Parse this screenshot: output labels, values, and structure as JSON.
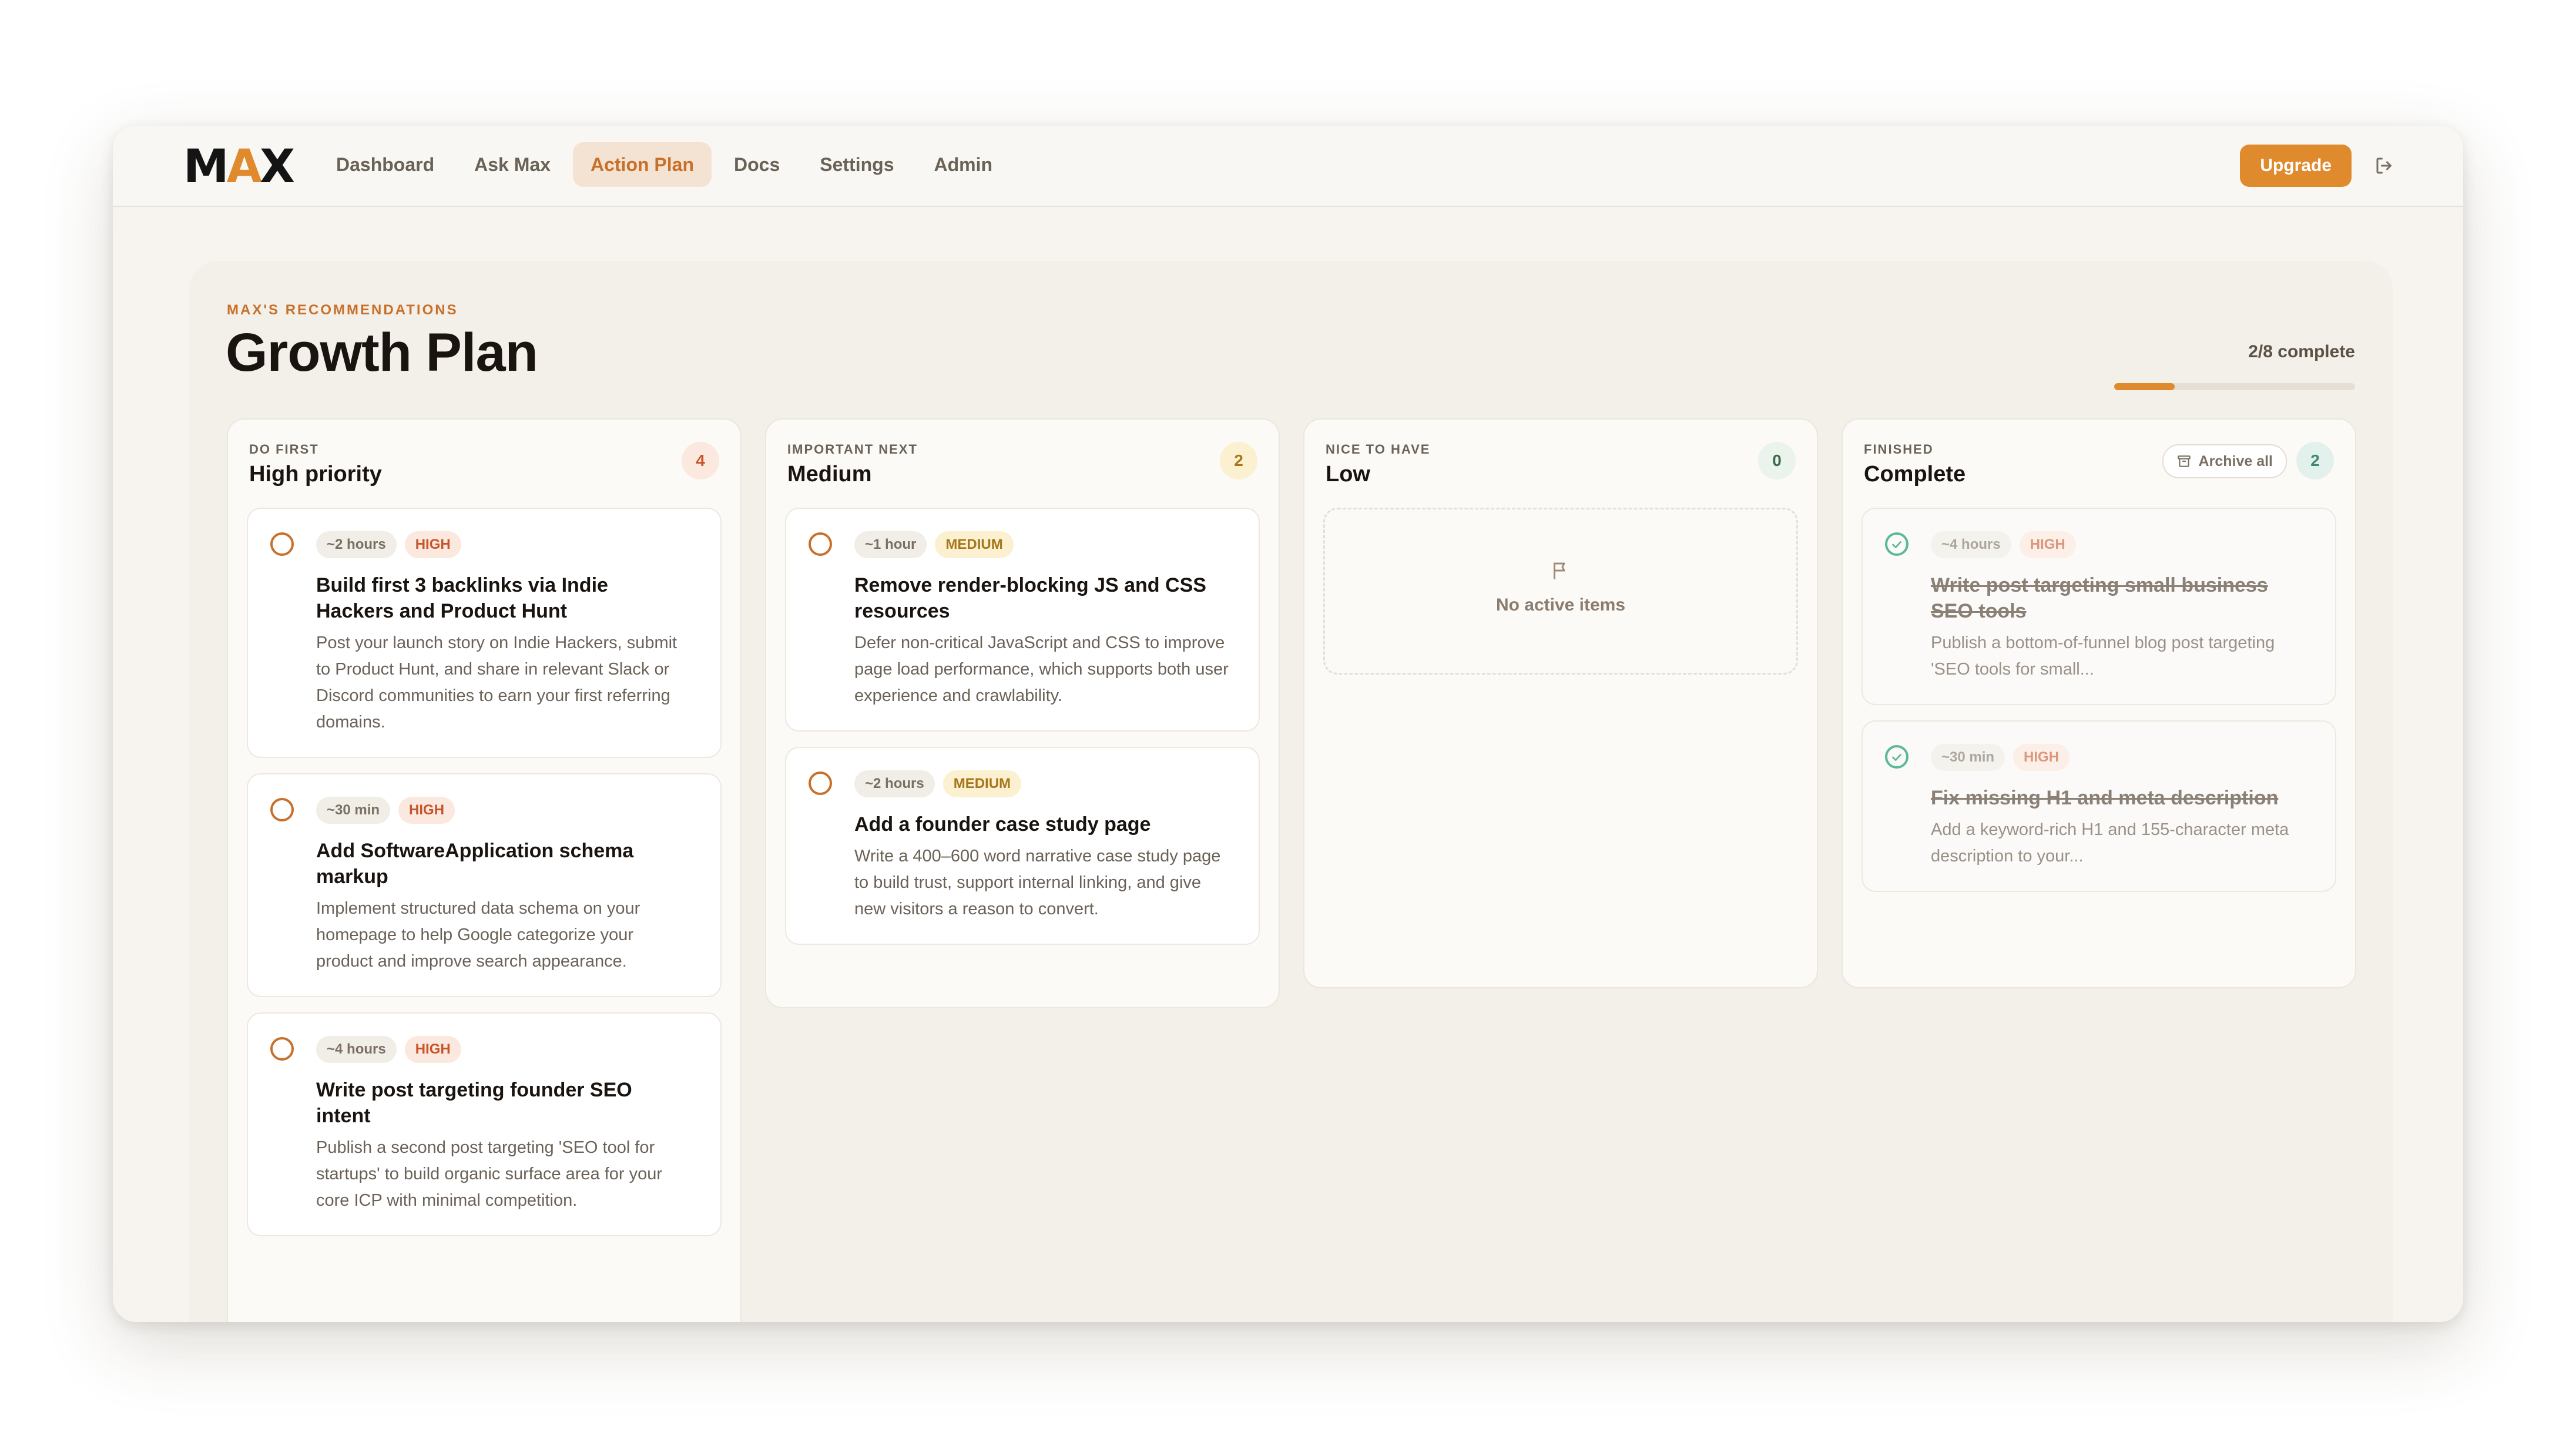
{
  "app": {
    "logo": {
      "m": "M",
      "a": "A",
      "x": "X"
    },
    "nav": [
      "Dashboard",
      "Ask Max",
      "Action Plan",
      "Docs",
      "Settings",
      "Admin"
    ],
    "active_nav": "Action Plan",
    "upgrade_label": "Upgrade",
    "accent": "#e08a2e"
  },
  "header": {
    "eyebrow": "MAX'S RECOMMENDATIONS",
    "title": "Growth Plan",
    "progress_label": "2/8 complete",
    "progress_completed": 2,
    "progress_total": 8
  },
  "columns": {
    "high": {
      "eyebrow": "DO FIRST",
      "title": "High priority",
      "count": "4",
      "cards": [
        {
          "time": "~2 hours",
          "priority": "HIGH",
          "title": "Build first 3 backlinks via Indie Hackers and Product Hunt",
          "desc": "Post your launch story on Indie Hackers, submit to Product Hunt, and share in relevant Slack or Discord communities to earn your first referring domains."
        },
        {
          "time": "~30 min",
          "priority": "HIGH",
          "title": "Add SoftwareApplication schema markup",
          "desc": "Implement structured data schema on your homepage to help Google categorize your product and improve search appearance."
        },
        {
          "time": "~4 hours",
          "priority": "HIGH",
          "title": "Write post targeting founder SEO intent",
          "desc": "Publish a second post targeting 'SEO tool for startups' to build organic surface area for your core ICP with minimal competition."
        }
      ]
    },
    "medium": {
      "eyebrow": "IMPORTANT NEXT",
      "title": "Medium",
      "count": "2",
      "cards": [
        {
          "time": "~1 hour",
          "priority": "MEDIUM",
          "title": "Remove render-blocking JS and CSS resources",
          "desc": "Defer non-critical JavaScript and CSS to improve page load performance, which supports both user experience and crawlability."
        },
        {
          "time": "~2 hours",
          "priority": "MEDIUM",
          "title": "Add a founder case study page",
          "desc": "Write a 400–600 word narrative case study page to build trust, support internal linking, and give new visitors a reason to convert."
        }
      ]
    },
    "low": {
      "eyebrow": "NICE TO HAVE",
      "title": "Low",
      "count": "0",
      "empty_text": "No active items"
    },
    "complete": {
      "eyebrow": "FINISHED",
      "title": "Complete",
      "count": "2",
      "archive_label": "Archive all",
      "cards": [
        {
          "time": "~4 hours",
          "priority": "HIGH",
          "title": "Write post targeting small business SEO tools",
          "desc": "Publish a bottom-of-funnel blog post targeting 'SEO tools for small..."
        },
        {
          "time": "~30 min",
          "priority": "HIGH",
          "title": "Fix missing H1 and meta description",
          "desc": "Add a keyword-rich H1 and 155-character meta description to your..."
        }
      ]
    }
  }
}
